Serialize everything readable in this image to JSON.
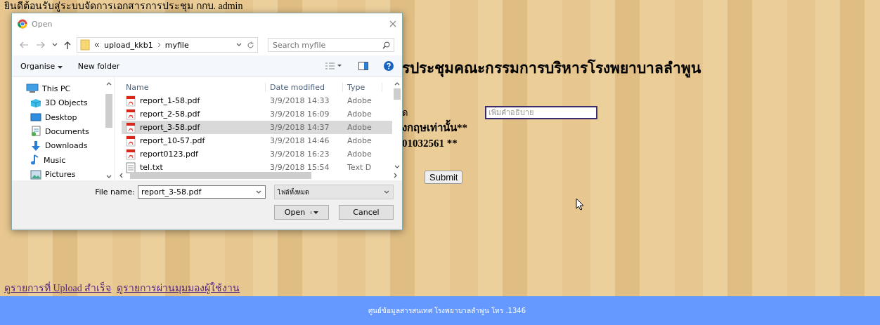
{
  "page": {
    "welcome": "ยินดีต้อนรับสู่ระบบจัดการเอกสารการประชุม กกบ. admin",
    "heading": "รประชุมคณะกรรมการบริหารโรงพยาบาลลำพูน",
    "form_labels": [
      "ด",
      "งกฤษเท่านั้น**",
      "01032561 **"
    ],
    "description_field": {
      "placeholder": "เพิ่มคำอธิบาย"
    },
    "submit": "Submit",
    "links": [
      "ดูรายการที่ Upload สำเร็จ",
      "ดูรายการผ่านมุมมองผู้ใช้งาน"
    ],
    "footer": "ศูนย์ข้อมูลสารสนเทศ โรงพยาบาลลำพูน โทร .1346"
  },
  "dialog": {
    "title": "Open",
    "path": [
      "upload_kkb1",
      "myfile"
    ],
    "search": {
      "placeholder": "Search myfile"
    },
    "toolbar": [
      "Organise",
      "New folder"
    ],
    "sidebar": [
      {
        "label": "This PC",
        "kind": "pc",
        "children": [
          {
            "label": "3D Objects",
            "kind": "cube"
          },
          {
            "label": "Desktop",
            "kind": "desktop"
          },
          {
            "label": "Documents",
            "kind": "documents"
          },
          {
            "label": "Downloads",
            "kind": "download"
          },
          {
            "label": "Music",
            "kind": "music"
          },
          {
            "label": "Pictures",
            "kind": "pictures"
          }
        ]
      }
    ],
    "columns": [
      "Name",
      "Date modified",
      "Type"
    ],
    "files": [
      {
        "name": "report_1-58.pdf",
        "date": "3/9/2018 14:33",
        "type": "Adobe",
        "kind": "pdf",
        "selected": false
      },
      {
        "name": "report_2-58.pdf",
        "date": "3/9/2018 16:09",
        "type": "Adobe",
        "kind": "pdf",
        "selected": false
      },
      {
        "name": "report_3-58.pdf",
        "date": "3/9/2018 14:37",
        "type": "Adobe",
        "kind": "pdf",
        "selected": true
      },
      {
        "name": "report_10-57.pdf",
        "date": "3/9/2018 14:46",
        "type": "Adobe",
        "kind": "pdf",
        "selected": false
      },
      {
        "name": "report0123.pdf",
        "date": "3/9/2018 16:23",
        "type": "Adobe",
        "kind": "pdf",
        "selected": false
      },
      {
        "name": "tel.txt",
        "date": "3/9/2018 15:54",
        "type": "Text D",
        "kind": "txt",
        "selected": false
      }
    ],
    "file_name_label": "File name:",
    "file_name": "report_3-58.pdf",
    "file_type": "ไฟล์ทั้งหมด",
    "open": "Open",
    "cancel": "Cancel"
  }
}
